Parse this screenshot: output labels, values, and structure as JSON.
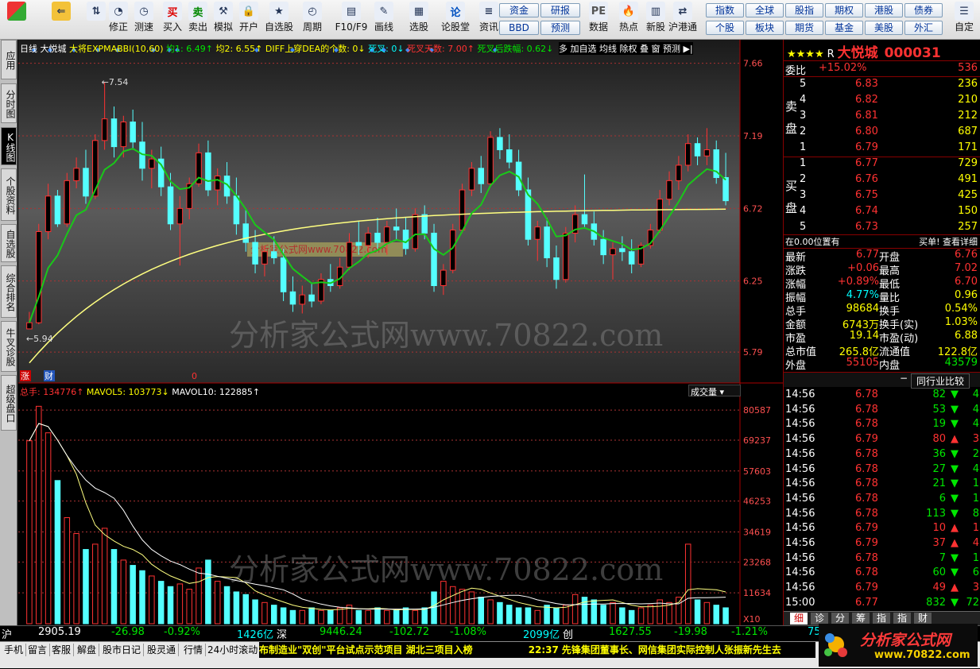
{
  "toolbar": {
    "buttons": [
      {
        "label": "",
        "icon": "window-grid-icon"
      },
      {
        "label": "",
        "icon": "back-arrow-icon"
      },
      {
        "label": "",
        "icon": "up-down-arrow-icon"
      },
      {
        "label": "修正",
        "icon": "clock-icon"
      },
      {
        "label": "测速",
        "icon": "stopwatch-icon"
      },
      {
        "label": "买入",
        "icon": "buy-icon",
        "glyph": "买"
      },
      {
        "label": "卖出",
        "icon": "sell-icon",
        "glyph": "卖"
      },
      {
        "label": "模拟",
        "icon": "hammer-icon"
      },
      {
        "label": "开户",
        "icon": "lock-icon"
      },
      {
        "label": "自选股",
        "icon": "star-icon"
      },
      {
        "label": "周期",
        "icon": "clock-period-icon"
      },
      {
        "label": "F10/F9",
        "icon": "f10-icon"
      },
      {
        "label": "画线",
        "icon": "pen-icon"
      },
      {
        "label": "选股",
        "icon": "select-stock-icon"
      },
      {
        "label": "论股堂",
        "icon": "lun-icon",
        "glyph": "论"
      },
      {
        "label": "资讯",
        "icon": "news-icon"
      },
      {
        "label": "数据",
        "icon": "pe-icon",
        "glyph": "PE"
      },
      {
        "label": "热点",
        "icon": "hot-icon"
      },
      {
        "label": "新股",
        "icon": "new-stock-icon"
      },
      {
        "label": "沪港通",
        "icon": "hk-connect-icon"
      },
      {
        "label": "自定",
        "icon": "custom-icon"
      }
    ],
    "mini_buttons": [
      "资金",
      "研报",
      "BBD",
      "预测",
      "指数",
      "全球",
      "股指",
      "期权",
      "港股",
      "债券",
      "个股",
      "板块",
      "期货",
      "基金",
      "美股",
      "外汇"
    ]
  },
  "side_tabs": [
    {
      "label": "应用",
      "active": false
    },
    {
      "label": "分时图",
      "active": false
    },
    {
      "label": "K线图",
      "active": true
    },
    {
      "label": "个股资料",
      "active": false
    },
    {
      "label": "自选股",
      "active": false
    },
    {
      "label": "综合排名",
      "active": false
    },
    {
      "label": "牛叉诊股",
      "active": false
    },
    {
      "label": "超级盘口",
      "active": false
    }
  ],
  "kline_header": {
    "period": "日线",
    "name": "大悦城",
    "indicator": "大将EXPMABBI(10,60)",
    "avg1": "均1: 6.49↑",
    "avg2": "均2: 6.55↑",
    "diff": "DIFF上穿DEA的个数: 0↓",
    "dead": "死叉: 0↓",
    "dead_days": "死叉天数: 7.00↑",
    "dead_drop": "死叉后跌幅: 0.62↓",
    "more": "多",
    "add_fav": "加自选",
    "ma_line": "均线",
    "adjust": "除权",
    "overlay": "叠",
    "window": "窗",
    "forecast": "预测"
  },
  "price_axis": [
    "7.66",
    "7.19",
    "6.72",
    "6.25",
    "5.79"
  ],
  "price_markers": {
    "high": "7.54",
    "low": "5.94"
  },
  "watermark": "分析家公式网www.70822.com",
  "watermark_box": "分析家公式网www.70822.com",
  "volume_header": {
    "total": "总手: 134776↑",
    "ma5": "MAVOL5: 103773↓",
    "ma10": "MAVOL10: 122885↑",
    "selector": "成交量"
  },
  "volume_axis": [
    "80587",
    "69237",
    "57603",
    "46253",
    "34619",
    "23268",
    "11634",
    "X10"
  ],
  "chart_tags": {
    "zhang": "涨",
    "cai": "财",
    "zero": "0"
  },
  "chart_data": {
    "type": "candlestick",
    "price_range": [
      5.6,
      7.72
    ],
    "volume_range": [
      0,
      86000
    ],
    "series_names": [
      "均1",
      "均2",
      "MAVOL5",
      "MAVOL10"
    ],
    "note_colors": {
      "up": "#ff3232",
      "down": "#54ffff",
      "ma1": "#19c819",
      "ma2": "#ffff80"
    },
    "candles": [
      [
        5.94,
        6.05,
        5.94,
        5.98
      ],
      [
        5.98,
        6.62,
        5.97,
        6.57
      ],
      [
        6.57,
        6.88,
        6.52,
        6.8
      ],
      [
        6.8,
        6.84,
        6.6,
        6.62
      ],
      [
        6.62,
        6.95,
        6.6,
        6.9
      ],
      [
        6.9,
        7.05,
        6.85,
        6.98
      ],
      [
        6.98,
        7.1,
        6.75,
        6.8
      ],
      [
        6.8,
        7.2,
        6.78,
        7.16
      ],
      [
        7.16,
        7.54,
        7.1,
        7.3
      ],
      [
        7.3,
        7.38,
        7.05,
        7.12
      ],
      [
        7.12,
        7.32,
        7.05,
        7.28
      ],
      [
        7.28,
        7.36,
        7.1,
        7.15
      ],
      [
        7.15,
        7.28,
        6.9,
        6.98
      ],
      [
        6.98,
        7.1,
        6.85,
        7.04
      ],
      [
        7.04,
        7.12,
        6.8,
        6.86
      ],
      [
        6.86,
        6.95,
        6.58,
        6.62
      ],
      [
        6.62,
        6.8,
        6.35,
        6.72
      ],
      [
        6.72,
        6.92,
        6.65,
        6.88
      ],
      [
        6.88,
        7.14,
        6.86,
        7.08
      ],
      [
        7.08,
        7.16,
        6.8,
        6.84
      ],
      [
        6.84,
        6.98,
        6.74,
        6.93
      ],
      [
        6.93,
        7.02,
        6.75,
        6.8
      ],
      [
        6.8,
        6.92,
        6.55,
        6.62
      ],
      [
        6.62,
        6.72,
        6.44,
        6.5
      ],
      [
        6.5,
        6.58,
        6.3,
        6.36
      ],
      [
        6.36,
        6.48,
        6.28,
        6.44
      ],
      [
        6.44,
        6.54,
        6.36,
        6.4
      ],
      [
        6.4,
        6.46,
        6.12,
        6.18
      ],
      [
        6.18,
        6.28,
        6.05,
        6.1
      ],
      [
        6.1,
        6.22,
        6.04,
        6.16
      ],
      [
        6.16,
        6.24,
        6.08,
        6.12
      ],
      [
        6.12,
        6.3,
        6.1,
        6.26
      ],
      [
        6.26,
        6.36,
        6.18,
        6.22
      ],
      [
        6.22,
        6.4,
        6.2,
        6.34
      ],
      [
        6.34,
        6.56,
        6.32,
        6.5
      ],
      [
        6.5,
        6.64,
        6.42,
        6.48
      ],
      [
        6.48,
        6.6,
        6.4,
        6.56
      ],
      [
        6.56,
        6.66,
        6.46,
        6.5
      ],
      [
        6.5,
        6.64,
        6.42,
        6.6
      ],
      [
        6.6,
        6.72,
        6.52,
        6.58
      ],
      [
        6.58,
        6.66,
        6.42,
        6.46
      ],
      [
        6.46,
        6.72,
        6.44,
        6.68
      ],
      [
        6.68,
        6.74,
        6.52,
        6.56
      ],
      [
        6.56,
        6.62,
        6.18,
        6.22
      ],
      [
        6.22,
        6.36,
        6.16,
        6.32
      ],
      [
        6.32,
        6.62,
        6.3,
        6.58
      ],
      [
        6.58,
        6.88,
        6.56,
        6.84
      ],
      [
        6.84,
        7.02,
        6.8,
        6.98
      ],
      [
        6.98,
        7.06,
        6.82,
        6.88
      ],
      [
        6.88,
        7.22,
        6.86,
        7.18
      ],
      [
        7.18,
        7.24,
        7.04,
        7.1
      ],
      [
        7.1,
        7.2,
        6.98,
        7.02
      ],
      [
        7.02,
        7.1,
        6.8,
        6.84
      ],
      [
        6.84,
        6.92,
        6.48,
        6.52
      ],
      [
        6.52,
        6.64,
        6.38,
        6.6
      ],
      [
        6.6,
        6.66,
        6.34,
        6.4
      ],
      [
        6.4,
        6.48,
        6.2,
        6.26
      ],
      [
        6.26,
        6.6,
        6.24,
        6.56
      ],
      [
        6.56,
        6.74,
        6.5,
        6.68
      ],
      [
        6.68,
        6.94,
        6.6,
        6.62
      ],
      [
        6.62,
        6.7,
        6.48,
        6.52
      ],
      [
        6.52,
        6.58,
        6.36,
        6.42
      ],
      [
        6.42,
        6.5,
        6.26,
        6.46
      ],
      [
        6.46,
        6.54,
        6.38,
        6.44
      ],
      [
        6.44,
        6.52,
        6.3,
        6.36
      ],
      [
        6.36,
        6.5,
        6.34,
        6.48
      ],
      [
        6.48,
        6.62,
        6.46,
        6.58
      ],
      [
        6.58,
        6.84,
        6.56,
        6.78
      ],
      [
        6.78,
        6.96,
        6.74,
        6.9
      ],
      [
        6.9,
        7.06,
        6.84,
        7.0
      ],
      [
        7.0,
        7.2,
        6.96,
        7.14
      ],
      [
        7.14,
        7.18,
        7.0,
        7.06
      ],
      [
        7.06,
        7.24,
        7.0,
        7.1
      ],
      [
        7.1,
        7.16,
        6.88,
        6.92
      ],
      [
        6.92,
        7.08,
        6.74,
        6.77
      ]
    ],
    "volumes": [
      69000,
      82000,
      72000,
      54000,
      40000,
      34000,
      28000,
      30000,
      36000,
      28000,
      24000,
      22000,
      20000,
      18000,
      16000,
      14000,
      15000,
      13000,
      21000,
      24000,
      16000,
      14000,
      12000,
      11000,
      9000,
      8000,
      7000,
      6000,
      5000,
      5000,
      6000,
      5000,
      5000,
      6000,
      7000,
      5000,
      5000,
      6000,
      5000,
      5000,
      6000,
      5000,
      6000,
      12000,
      16000,
      14000,
      13000,
      12000,
      10000,
      9000,
      8000,
      7000,
      6000,
      6000,
      5000,
      7000,
      6000,
      7000,
      11000,
      10000,
      9000,
      7000,
      8000,
      6000,
      5000,
      6000,
      7000,
      9000,
      8000,
      10000,
      30000,
      9000,
      8000,
      7000,
      6000
    ],
    "volume_colors_up": [
      true,
      true,
      true,
      false,
      true,
      true,
      false,
      true,
      true,
      false,
      true,
      false,
      false,
      true,
      false,
      false,
      true,
      true,
      true,
      false,
      true,
      false,
      false,
      false,
      false,
      true,
      false,
      false,
      false,
      true,
      false,
      true,
      false,
      true,
      true,
      false,
      true,
      false,
      true,
      false,
      false,
      true,
      false,
      false,
      true,
      true,
      true,
      true,
      false,
      true,
      false,
      false,
      false,
      false,
      true,
      false,
      false,
      true,
      true,
      false,
      false,
      false,
      true,
      false,
      false,
      true,
      true,
      true,
      true,
      true,
      true,
      false,
      true,
      false,
      false
    ]
  },
  "quote": {
    "stars": "★★★★",
    "r": "R",
    "name": "大悦城",
    "code": "000031",
    "weibi_label": "委比",
    "weibi_value": "+15.02%",
    "weibi_diff": "536",
    "sell_label": "卖盘",
    "buy_label": "买盘",
    "sells": [
      {
        "lvl": "5",
        "price": "6.83",
        "vol": "236"
      },
      {
        "lvl": "4",
        "price": "6.82",
        "vol": "210"
      },
      {
        "lvl": "3",
        "price": "6.81",
        "vol": "212"
      },
      {
        "lvl": "2",
        "price": "6.80",
        "vol": "687"
      },
      {
        "lvl": "1",
        "price": "6.79",
        "vol": "171"
      }
    ],
    "buys": [
      {
        "lvl": "1",
        "price": "6.77",
        "vol": "729"
      },
      {
        "lvl": "2",
        "price": "6.76",
        "vol": "491"
      },
      {
        "lvl": "3",
        "price": "6.75",
        "vol": "425"
      },
      {
        "lvl": "4",
        "price": "6.74",
        "vol": "150"
      },
      {
        "lvl": "5",
        "price": "6.73",
        "vol": "257"
      }
    ],
    "position_note": "在0.00位置有",
    "order_note": "买单! 查看详细",
    "stats": [
      {
        "l1": "最新",
        "v1": "6.77",
        "c1": "red",
        "l2": "开盘",
        "v2": "6.76",
        "c2": "red"
      },
      {
        "l1": "涨跌",
        "v1": "+0.06",
        "c1": "red",
        "l2": "最高",
        "v2": "7.02",
        "c2": "red"
      },
      {
        "l1": "涨幅",
        "v1": "+0.89%",
        "c1": "red",
        "l2": "最低",
        "v2": "6.70",
        "c2": "red"
      },
      {
        "l1": "振幅",
        "v1": "4.77%",
        "c1": "cyan",
        "l2": "量比",
        "v2": "0.96",
        "c2": "yellow"
      },
      {
        "l1": "总手",
        "v1": "98684",
        "c1": "yellow",
        "l2": "换手",
        "v2": "0.54%",
        "c2": "yellow"
      },
      {
        "l1": "金额",
        "v1": "6743万",
        "c1": "yellow",
        "l2": "换手(实)",
        "v2": "1.03%",
        "c2": "yellow"
      },
      {
        "l1": "市盈",
        "v1": "19.14",
        "c1": "yellow",
        "l2": "市盈(动)",
        "v2": "6.88",
        "c2": "yellow"
      },
      {
        "l1": "总市值",
        "v1": "265.8亿",
        "c1": "yellow",
        "l2": "流通值",
        "v2": "122.8亿",
        "c2": "yellow"
      },
      {
        "l1": "外盘",
        "v1": "55105",
        "c1": "red",
        "l2": "内盘",
        "v2": "43579",
        "c2": "green"
      }
    ],
    "industry_compare": "同行业比较",
    "ticks": [
      {
        "t": "14:56",
        "p": "6.78",
        "v": "82",
        "up": false,
        "n": "4"
      },
      {
        "t": "14:56",
        "p": "6.78",
        "v": "53",
        "up": false,
        "n": "4"
      },
      {
        "t": "14:56",
        "p": "6.78",
        "v": "19",
        "up": false,
        "n": "4"
      },
      {
        "t": "14:56",
        "p": "6.79",
        "v": "80",
        "up": true,
        "n": "3"
      },
      {
        "t": "14:56",
        "p": "6.78",
        "v": "36",
        "up": false,
        "n": "2"
      },
      {
        "t": "14:56",
        "p": "6.78",
        "v": "27",
        "up": false,
        "n": "4"
      },
      {
        "t": "14:56",
        "p": "6.78",
        "v": "21",
        "up": false,
        "n": "1"
      },
      {
        "t": "14:56",
        "p": "6.78",
        "v": "6",
        "up": false,
        "n": "1"
      },
      {
        "t": "14:56",
        "p": "6.78",
        "v": "113",
        "up": false,
        "n": "8"
      },
      {
        "t": "14:56",
        "p": "6.79",
        "v": "10",
        "up": true,
        "n": "1"
      },
      {
        "t": "14:56",
        "p": "6.79",
        "v": "37",
        "up": true,
        "n": "4"
      },
      {
        "t": "14:56",
        "p": "6.78",
        "v": "7",
        "up": false,
        "n": "1"
      },
      {
        "t": "14:56",
        "p": "6.78",
        "v": "60",
        "up": false,
        "n": "6"
      },
      {
        "t": "14:56",
        "p": "6.79",
        "v": "49",
        "up": true,
        "n": "3"
      },
      {
        "t": "15:00",
        "p": "6.77",
        "v": "832",
        "up": false,
        "n": "72"
      }
    ],
    "bottom_tabs": [
      "细",
      "诊",
      "分",
      "筹",
      "指",
      "指",
      "财"
    ]
  },
  "status": {
    "sh_label": "沪",
    "sh_index": "2905.19",
    "sh_change": "-26.98",
    "sh_pct": "-0.92%",
    "sh_amount": "1426亿",
    "sz_label": "深",
    "sz_index": "9446.24",
    "sz_change": "-102.72",
    "sz_pct": "-1.08%",
    "sz_amount": "2099亿",
    "cy_label": "创",
    "cy_index": "1627.55",
    "cy_change": "-19.98",
    "cy_pct": "-1.21%",
    "extra": "75"
  },
  "bottom": {
    "tabs": [
      "手机",
      "留言",
      "客服",
      "解盘",
      "股市日记",
      "股灵通",
      "行情",
      "24小时滚动"
    ],
    "news1": "布制造业\"双创\"平台试点示范项目 湖北三项目入榜",
    "news_time": "22:37",
    "news2": "先锋集团董事长、网信集团实际控制人张振新先生去"
  },
  "logo": {
    "title": "分析家公式网",
    "url": "www.70822.com"
  }
}
